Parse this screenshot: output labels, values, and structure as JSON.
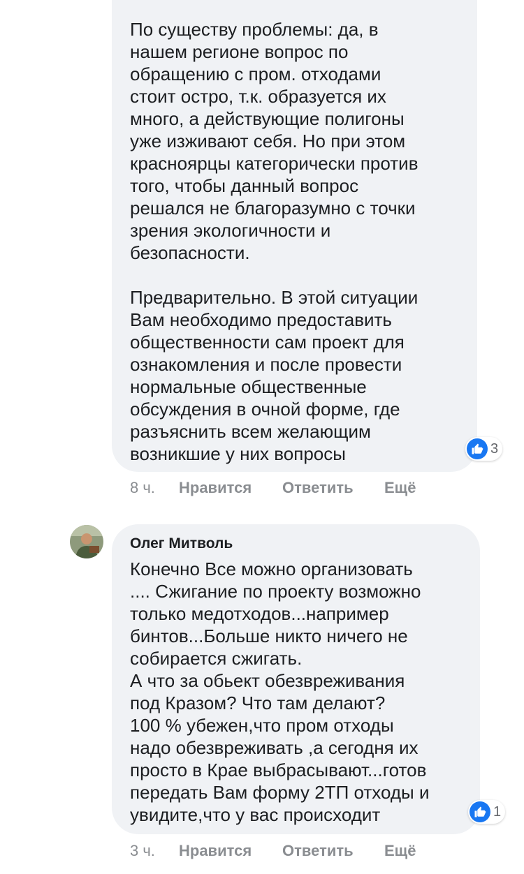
{
  "comments": [
    {
      "text": "По существу проблемы: да, в\nнашем регионе вопрос по\nобращению с пром. отходами\nстоит остро, т.к. образуется их\nмного, а действующие полигоны\nуже изживают себя. Но при этом\nкрасноярцы категорически против\nтого, чтобы данный вопрос\nрешался не благоразумно с точки\nзрения экологичности и\nбезопасности.\n\nПредварительно. В этой ситуации\nВам необходимо предоставить\nобщественности сам проект для\nознакомления и после провести\nнормальные общественные\nобсуждения в очной форме, где\nразъяснить всем желающим\nвозникшие у них вопросы",
      "reaction_count": "3",
      "time": "8 ч.",
      "like_label": "Нравится",
      "reply_label": "Ответить",
      "more_label": "Ещё"
    },
    {
      "author": "Олег Митволь",
      "text": "Конечно Все можно организовать\n.... Сжигание по проекту возможно\nтолько медотходов...например\nбинтов...Больше никто ничего не\nсобирается сжигать.\nА что за обьект обезвреживания\nпод Кразом? Что там делают?\n100 % убежен,что пром отходы\nнадо обезвреживать ,а сегодня их\nпросто в Крае выбрасывают...готов\nпередать Вам форму 2ТП отходы и\nувидите,что у вас происходит",
      "reaction_count": "1",
      "time": "3 ч.",
      "like_label": "Нравится",
      "reply_label": "Ответить",
      "more_label": "Ещё"
    }
  ],
  "colors": {
    "bubble": "#f0f2f5",
    "text": "#1c1e21",
    "meta": "#8a8d91",
    "like": "#1877f2"
  },
  "icons": [
    "like-icon",
    "avatar"
  ]
}
